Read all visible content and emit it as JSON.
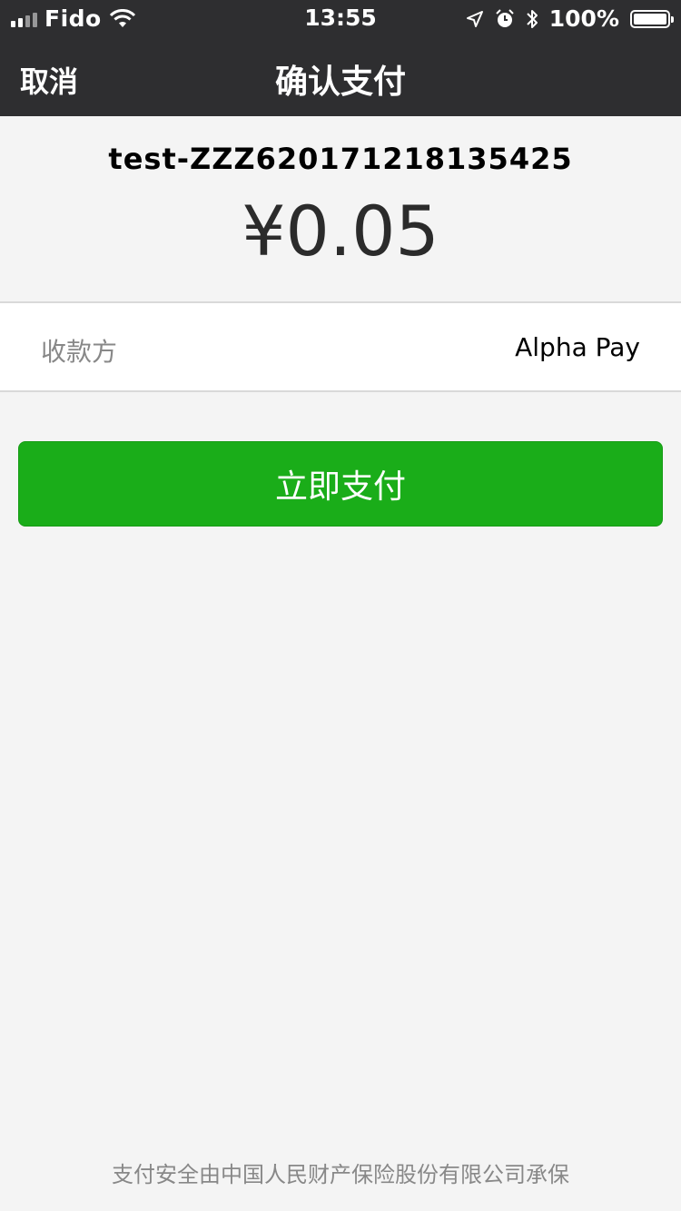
{
  "status_bar": {
    "carrier": "Fido",
    "time": "13:55",
    "battery_percent": "100%",
    "icons": [
      "signal-icon",
      "wifi-icon",
      "location-arrow-icon",
      "alarm-icon",
      "bluetooth-icon",
      "battery-icon"
    ]
  },
  "nav": {
    "cancel_label": "取消",
    "title": "确认支付"
  },
  "summary": {
    "order_id": "test-ZZZ620171218135425",
    "amount": "¥0.05"
  },
  "payee": {
    "label": "收款方",
    "value": "Alpha Pay"
  },
  "actions": {
    "pay_now_label": "立即支付"
  },
  "footer": {
    "text": "支付安全由中国人民财产保险股份有限公司承保"
  },
  "colors": {
    "nav_background": "#2e2e30",
    "primary_button": "#1aad19",
    "page_background": "#f4f4f4"
  }
}
